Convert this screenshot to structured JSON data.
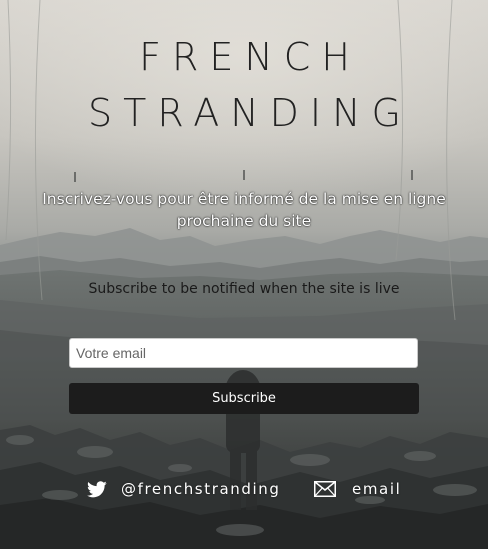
{
  "header": {
    "title_line1": "FRENCH",
    "title_line2": "STRANDING"
  },
  "intro": {
    "fr_text": "Inscrivez-vous pour être informé de la mise en ligne prochaine du site",
    "en_text": "Subscribe to be notified when the site is live"
  },
  "form": {
    "email_placeholder": "Votre email",
    "email_value": "",
    "subscribe_label": "Subscribe"
  },
  "social": {
    "twitter_handle": "@frenchstranding",
    "twitter_icon": "twitter-bird-icon",
    "email_label": "email",
    "email_icon": "envelope-icon"
  },
  "colors": {
    "button_bg": "#1c1c1c",
    "button_text": "#ffffff",
    "title_text": "#222222",
    "social_text": "#ffffff"
  }
}
